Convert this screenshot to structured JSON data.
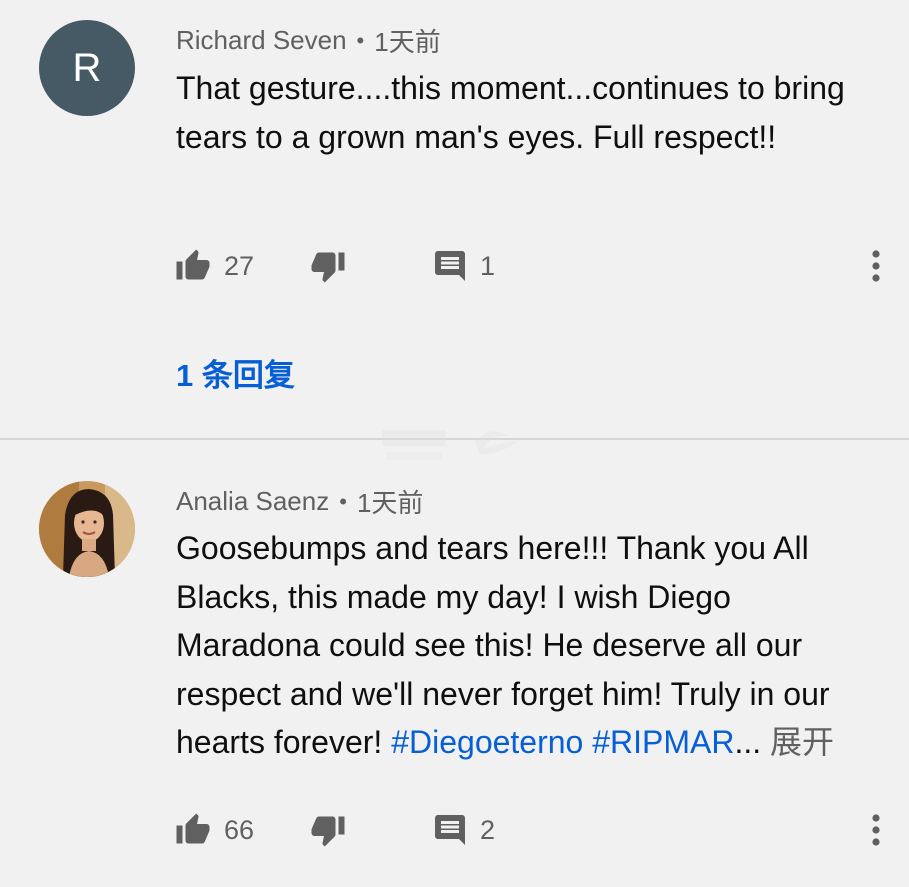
{
  "comments": [
    {
      "author": "Richard Seven",
      "avatar_letter": "R",
      "separator": "•",
      "time": "1天前",
      "text": "That gesture....this moment...continues to bring tears to a grown man's eyes. Full respect!!",
      "likes": "27",
      "reply_count": "1",
      "replies_link": "1 条回复"
    },
    {
      "author": "Analia Saenz",
      "separator": "•",
      "time": "1天前",
      "text": "Goosebumps and tears here!!! Thank you All Blacks, this made my day! I wish Diego Maradona could see this! He deserve all our respect and we'll never forget him! Truly in our hearts forever! ",
      "hashtags": "#Diegoeterno #RIPMAR",
      "ellipsis": "...",
      "expand_label": "展开",
      "likes": "66",
      "reply_count": "2"
    }
  ],
  "colors": {
    "background": "#f1f1f1",
    "link_blue": "#065fd4",
    "secondary_text": "#606060",
    "avatar_bg": "#455a64"
  },
  "icons": [
    "thumbs-up-icon",
    "thumbs-down-icon",
    "comment-icon",
    "more-vert-icon"
  ]
}
